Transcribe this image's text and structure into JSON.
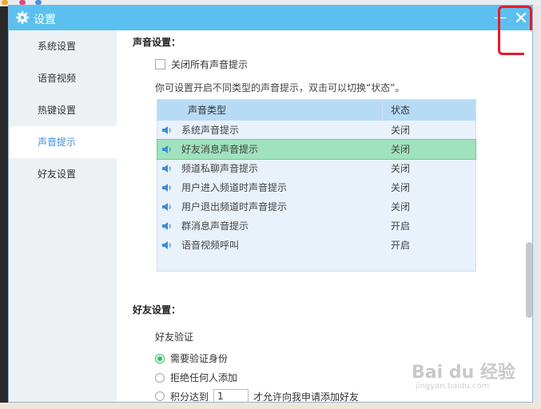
{
  "window": {
    "title": "设置",
    "minimize": "—"
  },
  "sidebar": {
    "items": [
      {
        "label": "系统设置",
        "active": false
      },
      {
        "label": "语音视频",
        "active": false
      },
      {
        "label": "热键设置",
        "active": false
      },
      {
        "label": "声音提示",
        "active": true
      },
      {
        "label": "好友设置",
        "active": false
      }
    ]
  },
  "sound": {
    "title": "声音设置：",
    "mute_all_label": "关闭所有声音提示",
    "hint": "你可设置开启不同类型的声音提示，双击可以切换“状态”。",
    "table": {
      "col_type": "声音类型",
      "col_status": "状态",
      "rows": [
        {
          "type": "系统声音提示",
          "status": "关闭"
        },
        {
          "type": "好友消息声音提示",
          "status": "关闭"
        },
        {
          "type": "频道私聊声音提示",
          "status": "关闭"
        },
        {
          "type": "用户进入频道时声音提示",
          "status": "关闭"
        },
        {
          "type": "用户退出频道时声音提示",
          "status": "关闭"
        },
        {
          "type": "群消息声音提示",
          "status": "开启"
        },
        {
          "type": "语音视频呼叫",
          "status": "开启"
        }
      ]
    }
  },
  "friend": {
    "title": "好友设置：",
    "verify_label": "好友验证",
    "options": [
      {
        "label": "需要验证身份",
        "selected": true
      },
      {
        "label": "拒绝任何人添加",
        "selected": false
      }
    ],
    "score_prefix": "积分达到",
    "score_value": "1",
    "score_suffix": "才允许向我申请添加好友"
  },
  "watermark": {
    "text": "Bai du 经验",
    "sub": "jingyan.baidu.com"
  },
  "colors": {
    "titlebar": "#5bc0f0",
    "accent": "#3d8fd4",
    "selected_row": "#9fe2bd",
    "highlight": "#e8192c"
  }
}
